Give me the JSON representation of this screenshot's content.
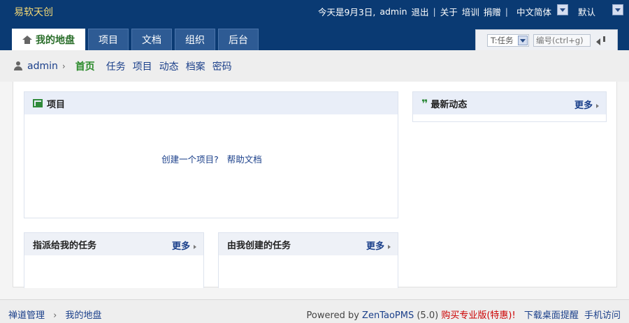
{
  "brand": "易软天创",
  "topbar": {
    "today": "今天是9月3日,",
    "user": "admin",
    "logout": "退出",
    "about": "关于",
    "training": "培训",
    "donate": "捐赠",
    "language": "中文简体",
    "theme": "默认"
  },
  "tabs": [
    {
      "label": "我的地盘",
      "active": true
    },
    {
      "label": "项目"
    },
    {
      "label": "文档"
    },
    {
      "label": "组织"
    },
    {
      "label": "后台"
    }
  ],
  "search": {
    "type": "T:任务",
    "placeholder": "编号(ctrl+g)"
  },
  "subnav": {
    "user": "admin",
    "items": [
      "首页",
      "任务",
      "项目",
      "动态",
      "档案",
      "密码"
    ]
  },
  "blocks": {
    "projects": {
      "title": "项目",
      "create_link": "创建一个项目?",
      "help_link": "帮助文档"
    },
    "dynamics": {
      "title": "最新动态",
      "more": "更多"
    },
    "assigned": {
      "title": "指派给我的任务",
      "more": "更多"
    },
    "created": {
      "title": "由我创建的任务",
      "more": "更多"
    }
  },
  "footer": {
    "crumb_root": "禅道管理",
    "crumb_current": "我的地盘",
    "powered_text": "Powered by",
    "product": "ZenTaoPMS",
    "version": "(5.0)",
    "buy": "购买专业版(特惠)!",
    "download": "下载桌面提醒",
    "mobile": "手机访问"
  }
}
